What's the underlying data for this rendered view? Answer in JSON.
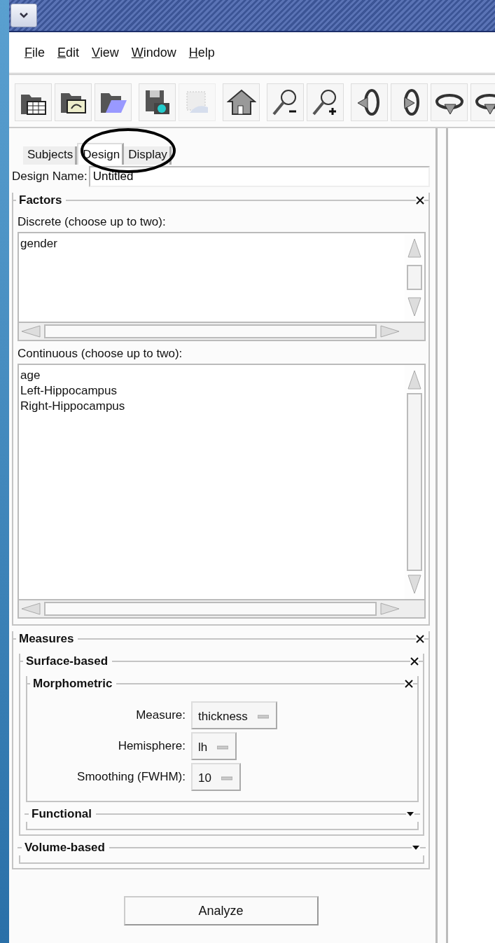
{
  "menu": [
    {
      "label": "File"
    },
    {
      "label": "Edit"
    },
    {
      "label": "View"
    },
    {
      "label": "Window"
    },
    {
      "label": "Help"
    }
  ],
  "toolbar": [
    {
      "kind": "table-folder",
      "disabled": false
    },
    {
      "kind": "image-folder",
      "disabled": false
    },
    {
      "kind": "open-folder",
      "disabled": false
    },
    {
      "kind": "save-camera",
      "disabled": false
    },
    {
      "kind": "save-picture",
      "disabled": true
    },
    {
      "kind": "home",
      "disabled": false
    },
    {
      "kind": "zoom-out",
      "disabled": false
    },
    {
      "kind": "zoom-in",
      "disabled": false
    },
    {
      "kind": "rotate-left",
      "disabled": false
    },
    {
      "kind": "rotate-right",
      "disabled": false
    },
    {
      "kind": "rotate-down",
      "disabled": false
    },
    {
      "kind": "rotate-up",
      "disabled": false
    }
  ],
  "tabs": [
    {
      "label": "Subjects",
      "selected": false
    },
    {
      "label": "Design",
      "selected": true
    },
    {
      "label": "Display",
      "selected": false
    }
  ],
  "design_name": {
    "label": "Design Name:",
    "value": "Untitled"
  },
  "factors": {
    "title": "Factors",
    "expanded": true,
    "discrete": {
      "label": "Discrete (choose up to two):",
      "items": [
        {
          "label": "gender",
          "selected": false
        }
      ]
    },
    "continuous": {
      "label": "Continuous (choose up to two):",
      "items": [
        {
          "label": "age",
          "selected": false
        },
        {
          "label": "Left-Hippocampus",
          "selected": false
        },
        {
          "label": "Right-Hippocampus",
          "selected": false
        }
      ]
    }
  },
  "measures": {
    "title": "Measures",
    "expanded": true,
    "children": [
      {
        "title": "Surface-based",
        "expanded": true,
        "children": [
          {
            "title": "Morphometric",
            "expanded": true,
            "fields": [
              {
                "label": "Measure:",
                "value": "thickness"
              },
              {
                "label": "Hemisphere:",
                "value": "lh"
              },
              {
                "label": "Smoothing (FWHM):",
                "value": "10"
              }
            ]
          },
          {
            "title": "Functional",
            "expanded": false
          }
        ]
      },
      {
        "title": "Volume-based",
        "expanded": false
      }
    ]
  },
  "analyze_button": "Analyze"
}
